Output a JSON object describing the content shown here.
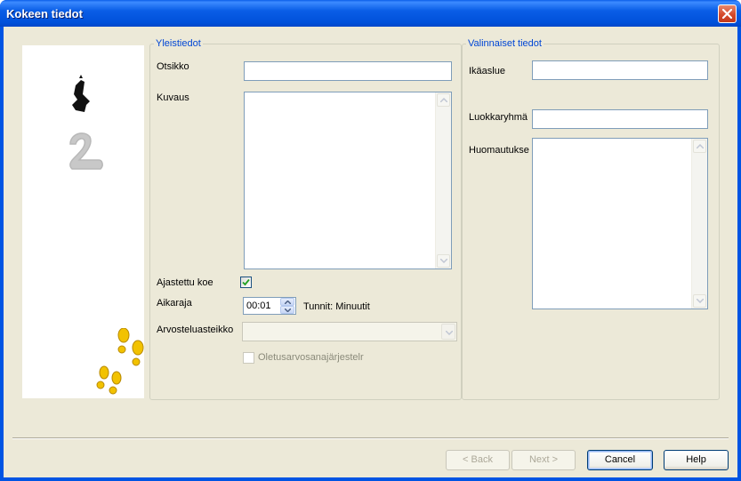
{
  "window": {
    "title": "Kokeen tiedot"
  },
  "general": {
    "legend": "Yleistiedot",
    "title_label": "Otsikko",
    "title_value": "",
    "description_label": "Kuvaus",
    "description_value": "",
    "timed_label": "Ajastettu koe",
    "timed_checked": true,
    "time_limit_label": "Aikaraja",
    "time_limit_value": "00:01",
    "time_limit_unit": "Tunnit: Minuutit",
    "grading_scale_label": "Arvosteluasteikko",
    "grading_scale_value": "",
    "default_grade_label": "Oletusarvosanajärjestelr",
    "default_grade_checked": false
  },
  "optional": {
    "legend": "Valinnaiset tiedot",
    "age_range_label": "Ikäaslue",
    "age_range_value": "",
    "class_group_label": "Luokkaryhmä",
    "class_group_value": "",
    "notes_label": "Huomautukse",
    "notes_value": ""
  },
  "buttons": {
    "back": "< Back",
    "next": "Next >",
    "cancel": "Cancel",
    "help": "Help"
  },
  "icons": {
    "close": "close-icon",
    "step_numbers": "step-numbers-icon",
    "footprints": "footprints-icon"
  }
}
